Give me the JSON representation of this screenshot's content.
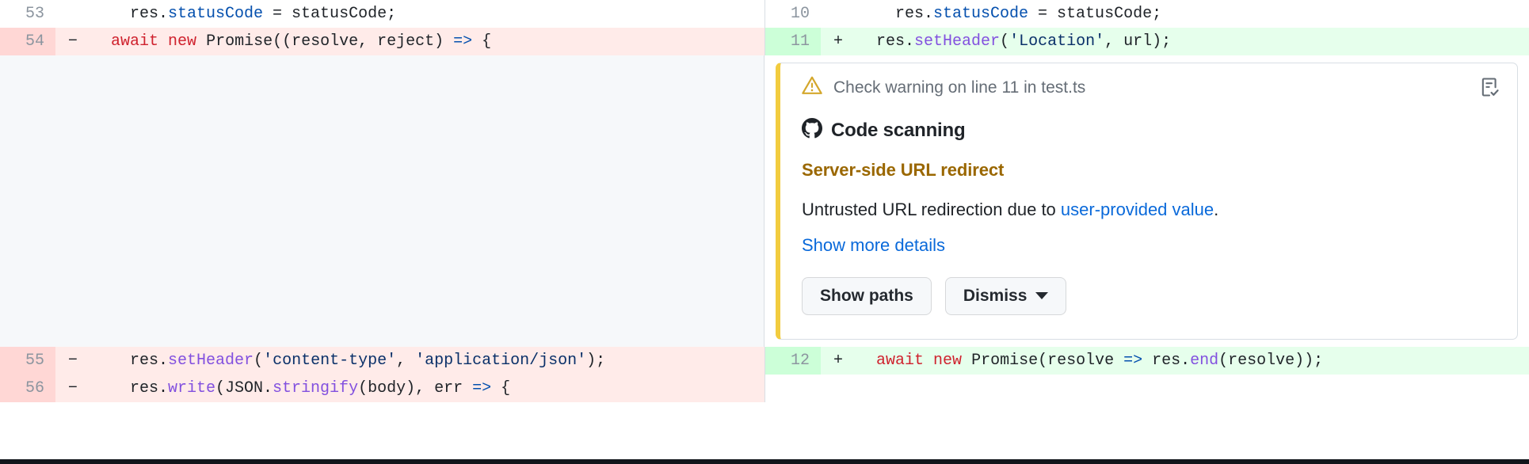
{
  "diff": {
    "rows": [
      {
        "kind": "context-pair",
        "left": {
          "line": "53",
          "marker": "",
          "type": "context",
          "tokens": [
            {
              "text": "    res.",
              "cls": "t-plain"
            },
            {
              "text": "statusCode",
              "cls": "t-prop"
            },
            {
              "text": " = statusCode;",
              "cls": "t-plain"
            }
          ]
        },
        "right": {
          "line": "10",
          "marker": "",
          "type": "context",
          "tokens": [
            {
              "text": "    res.",
              "cls": "t-plain"
            },
            {
              "text": "statusCode",
              "cls": "t-prop"
            },
            {
              "text": " = statusCode;",
              "cls": "t-plain"
            }
          ]
        }
      },
      {
        "kind": "change-pair",
        "left": {
          "line": "54",
          "marker": "−",
          "type": "deletion",
          "tokens": [
            {
              "text": "  ",
              "cls": "t-plain"
            },
            {
              "text": "await",
              "cls": "t-kw"
            },
            {
              "text": " ",
              "cls": "t-plain"
            },
            {
              "text": "new",
              "cls": "t-kw"
            },
            {
              "text": " Promise((resolve, reject) ",
              "cls": "t-plain"
            },
            {
              "text": "=>",
              "cls": "t-op"
            },
            {
              "text": " {",
              "cls": "t-plain"
            }
          ]
        },
        "right": {
          "line": "11",
          "marker": "+",
          "type": "addition",
          "tokens": [
            {
              "text": "  res.",
              "cls": "t-plain"
            },
            {
              "text": "setHeader",
              "cls": "t-fn"
            },
            {
              "text": "(",
              "cls": "t-plain"
            },
            {
              "text": "'Location'",
              "cls": "t-str"
            },
            {
              "text": ", url);",
              "cls": "t-plain"
            }
          ]
        }
      }
    ],
    "bottom_rows": [
      {
        "kind": "change-pair",
        "left": {
          "line": "55",
          "marker": "−",
          "type": "deletion",
          "tokens": [
            {
              "text": "    res.",
              "cls": "t-plain"
            },
            {
              "text": "setHeader",
              "cls": "t-fn"
            },
            {
              "text": "(",
              "cls": "t-plain"
            },
            {
              "text": "'content-type'",
              "cls": "t-str"
            },
            {
              "text": ", ",
              "cls": "t-plain"
            },
            {
              "text": "'application/json'",
              "cls": "t-str"
            },
            {
              "text": ");",
              "cls": "t-plain"
            }
          ]
        },
        "right": {
          "line": "12",
          "marker": "+",
          "type": "addition",
          "tokens": [
            {
              "text": "  ",
              "cls": "t-plain"
            },
            {
              "text": "await",
              "cls": "t-kw"
            },
            {
              "text": " ",
              "cls": "t-kw"
            },
            {
              "text": "new",
              "cls": "t-kw"
            },
            {
              "text": " Promise(resolve ",
              "cls": "t-plain"
            },
            {
              "text": "=>",
              "cls": "t-op"
            },
            {
              "text": " res.",
              "cls": "t-plain"
            },
            {
              "text": "end",
              "cls": "t-fn"
            },
            {
              "text": "(resolve));",
              "cls": "t-plain"
            }
          ]
        }
      },
      {
        "kind": "change-pair",
        "left": {
          "line": "56",
          "marker": "−",
          "type": "deletion",
          "tokens": [
            {
              "text": "    res.",
              "cls": "t-plain"
            },
            {
              "text": "write",
              "cls": "t-fn"
            },
            {
              "text": "(JSON.",
              "cls": "t-plain"
            },
            {
              "text": "stringify",
              "cls": "t-fn"
            },
            {
              "text": "(body), err ",
              "cls": "t-plain"
            },
            {
              "text": "=>",
              "cls": "t-op"
            },
            {
              "text": " {",
              "cls": "t-plain"
            }
          ]
        },
        "right": {
          "line": "",
          "marker": "",
          "type": "blank",
          "tokens": []
        }
      }
    ]
  },
  "alert": {
    "header_text": "Check warning on line 11 in test.ts",
    "warning_icon": "alert-triangle-icon",
    "report_icon": "checklist-report-icon",
    "tool_icon": "github-mark-icon",
    "tool_name": "Code scanning",
    "rule_title": "Server-side URL redirect",
    "description_prefix": "Untrusted URL redirection due to ",
    "description_link": "user-provided value",
    "description_suffix": ".",
    "show_more_label": "Show more details",
    "buttons": {
      "show_paths": "Show paths",
      "dismiss": "Dismiss"
    }
  },
  "colors": {
    "warning_accent": "#f2cc3f",
    "rule_title": "#9a6700",
    "link": "#0969da",
    "deletion_bg": "#ffebe9",
    "deletion_gutter": "#ffd7d5",
    "addition_bg": "#e6ffec",
    "addition_gutter": "#ccffd8"
  }
}
